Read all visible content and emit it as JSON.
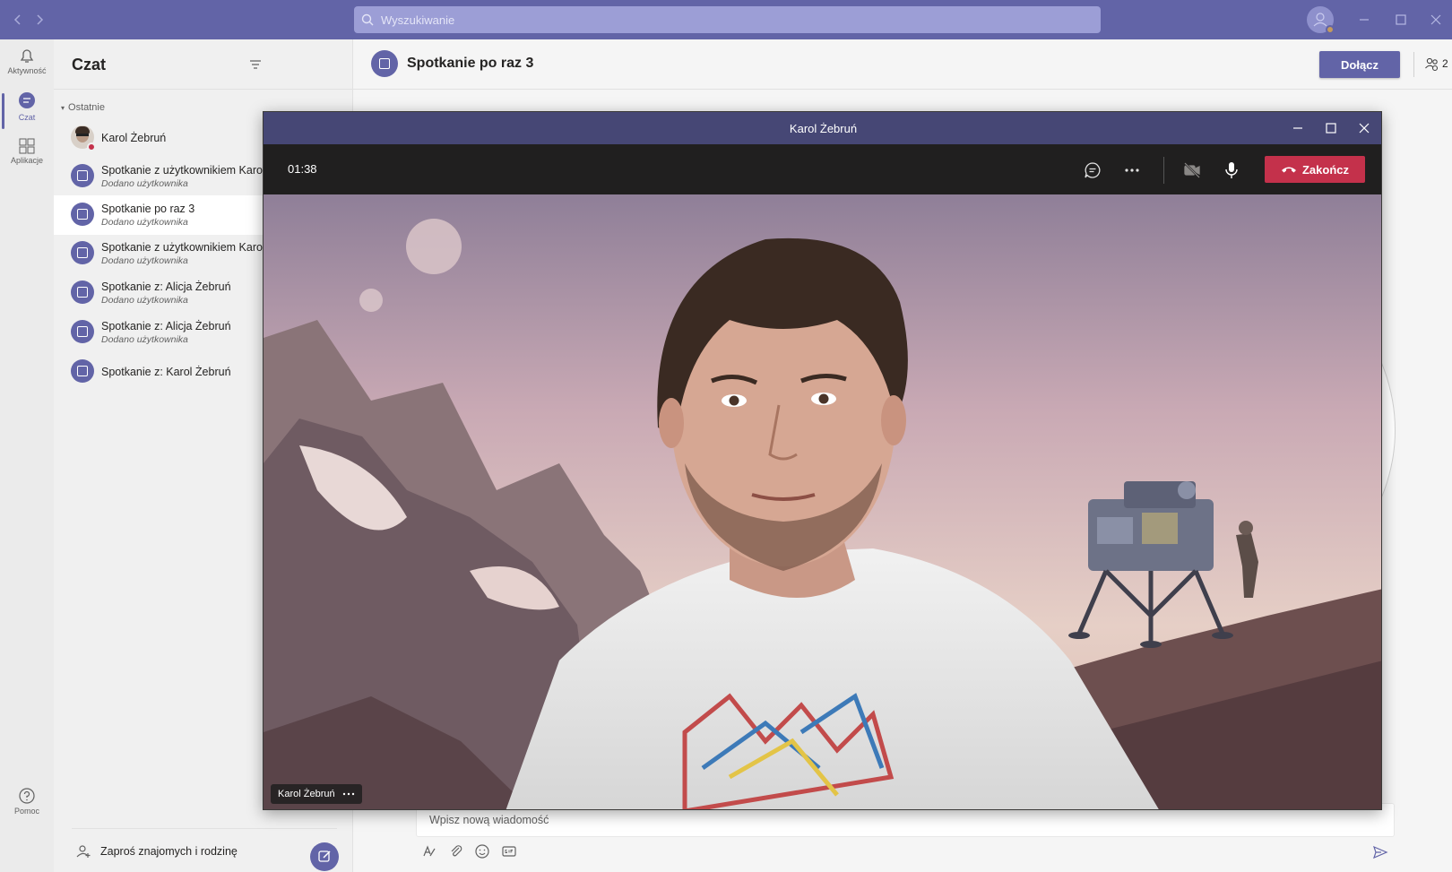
{
  "app": {
    "search_placeholder": "Wyszukiwanie",
    "accent_color": "#6264a7"
  },
  "rail": {
    "activity_label": "Aktywność",
    "chat_label": "Czat",
    "apps_label": "Aplikacje",
    "help_label": "Pomoc"
  },
  "chatlist": {
    "title": "Czat",
    "section_label": "Ostatnie",
    "items": [
      {
        "name": "Karol Żebruń",
        "subtitle": ""
      },
      {
        "name": "Spotkanie z użytkownikiem Karol",
        "subtitle": "Dodano użytkownika"
      },
      {
        "name": "Spotkanie po raz 3",
        "subtitle": "Dodano użytkownika"
      },
      {
        "name": "Spotkanie z użytkownikiem Karol",
        "subtitle": "Dodano użytkownika"
      },
      {
        "name": "Spotkanie z: Alicja Żebruń",
        "subtitle": "Dodano użytkownika"
      },
      {
        "name": "Spotkanie z: Alicja Żebruń",
        "subtitle": "Dodano użytkownika"
      },
      {
        "name": "Spotkanie z: Karol Żebruń",
        "subtitle": ""
      }
    ],
    "selected_index": 2,
    "invite_label": "Zaproś znajomych i rodzinę"
  },
  "main": {
    "title": "Spotkanie po raz 3",
    "join_label": "Dołącz",
    "participants_count": "2",
    "compose_placeholder": "Wpisz nową wiadomość"
  },
  "call": {
    "window_title": "Karol Żebruń",
    "timer": "01:38",
    "hangup_label": "Zakończ",
    "participant_name": "Karol Żebruń",
    "hangup_color": "#c4314b"
  }
}
